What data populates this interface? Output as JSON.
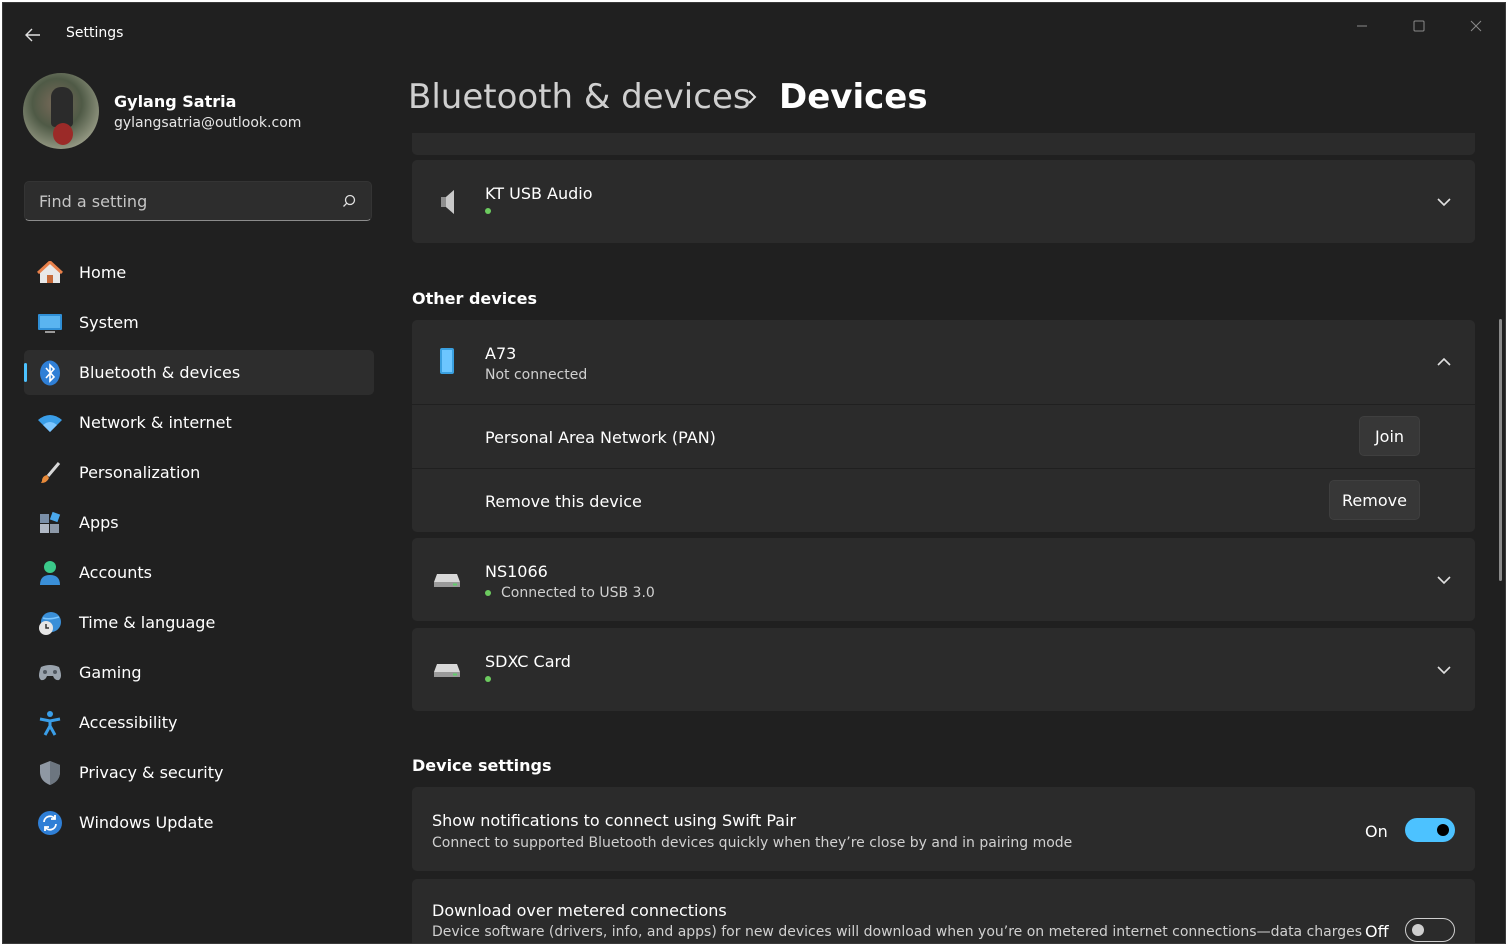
{
  "app": {
    "title": "Settings"
  },
  "user": {
    "name": "Gylang Satria",
    "email": "gylangsatria@outlook.com"
  },
  "search": {
    "placeholder": "Find a setting"
  },
  "sidebar": {
    "items": [
      {
        "label": "Home",
        "icon": "home-icon"
      },
      {
        "label": "System",
        "icon": "system-icon"
      },
      {
        "label": "Bluetooth & devices",
        "icon": "bluetooth-icon",
        "active": true
      },
      {
        "label": "Network & internet",
        "icon": "wifi-icon"
      },
      {
        "label": "Personalization",
        "icon": "brush-icon"
      },
      {
        "label": "Apps",
        "icon": "apps-icon"
      },
      {
        "label": "Accounts",
        "icon": "person-icon"
      },
      {
        "label": "Time & language",
        "icon": "globe-clock-icon"
      },
      {
        "label": "Gaming",
        "icon": "gamepad-icon"
      },
      {
        "label": "Accessibility",
        "icon": "accessibility-icon"
      },
      {
        "label": "Privacy & security",
        "icon": "shield-icon"
      },
      {
        "label": "Windows Update",
        "icon": "update-icon"
      }
    ]
  },
  "header": {
    "parent": "Bluetooth & devices",
    "current": "Devices"
  },
  "devices": {
    "kt_usb_audio": {
      "name": "KT USB Audio",
      "icon": "speaker-icon"
    },
    "other_title": "Other devices",
    "a73": {
      "name": "A73",
      "status": "Not connected",
      "icon": "phone-icon",
      "pan_label": "Personal Area Network (PAN)",
      "join_label": "Join",
      "remove_row_label": "Remove this device",
      "remove_label": "Remove"
    },
    "ns1066": {
      "name": "NS1066",
      "status": "Connected to USB 3.0",
      "icon": "drive-icon"
    },
    "sdxc": {
      "name": "SDXC Card",
      "icon": "drive-icon"
    }
  },
  "device_settings": {
    "title": "Device settings",
    "swift_pair": {
      "title": "Show notifications to connect using Swift Pair",
      "desc": "Connect to supported Bluetooth devices quickly when they’re close by and in pairing mode",
      "state": "On"
    },
    "metered": {
      "title": "Download over metered connections",
      "desc": "Device software (drivers, info, and apps) for new devices will download when you’re on metered internet connections—data charges",
      "state": "Off"
    }
  },
  "colors": {
    "accent": "#4cc2ff",
    "background": "#202020",
    "card": "#2b2b2b",
    "connected": "#6ccb5f"
  }
}
